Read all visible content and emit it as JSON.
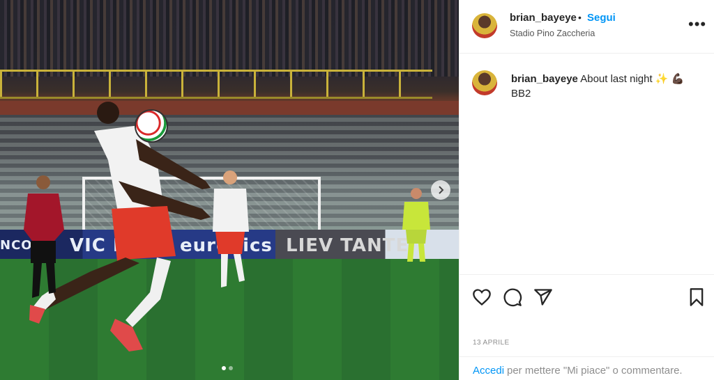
{
  "post": {
    "image_alt": "Footballer controlling the ball on his chest",
    "ad_texts": [
      "NCO",
      "VIC NO",
      "eurenics",
      "LIEV TANTE"
    ],
    "carousel": {
      "current": 1,
      "total": 2
    }
  },
  "header": {
    "username": "brian_bayeye",
    "separator": "•",
    "follow_label": "Segui",
    "location": "Stadio Pino Zaccheria",
    "more_label": "•••"
  },
  "caption": {
    "username": "brian_bayeye",
    "text": "About last night ✨ 💪🏿",
    "line2": "BB2"
  },
  "actions": {
    "like_icon": "heart-icon",
    "comment_icon": "comment-icon",
    "share_icon": "share-icon",
    "save_icon": "bookmark-icon"
  },
  "date": "13 APRILE",
  "footer": {
    "login_label": "Accedi",
    "text": "per mettere \"Mi piace\" o commentare."
  },
  "colors": {
    "accent": "#0095f6",
    "text": "#262626",
    "muted": "#8e8e8e"
  }
}
